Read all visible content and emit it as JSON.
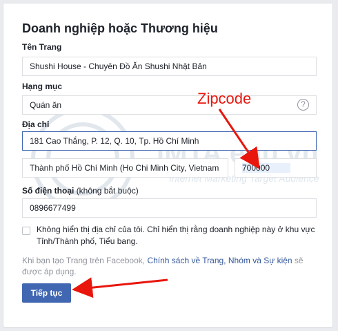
{
  "form": {
    "title": "Doanh nghiệp hoặc Thương hiệu",
    "page_name_label": "Tên Trang",
    "page_name_value": "Shushi House - Chuyên Đồ Ăn Shushi Nhật Bản",
    "category_label": "Hạng mục",
    "category_value": "Quán ăn",
    "help_glyph": "?",
    "address_label": "Địa chỉ",
    "address_value": "181 Cao Thắng, P. 12, Q. 10, Tp. Hồ Chí Minh",
    "city_value": "Thành phố Hồ Chí Minh (Ho Chi Minh City, Vietnam",
    "zip_value": "700000",
    "phone_label": "Số điện thoại",
    "phone_optional": "(không bắt buộc)",
    "phone_value": "0896677499",
    "hide_address_text": "Không hiển thị địa chỉ của tôi. Chỉ hiển thị rằng doanh nghiệp này ở khu vực Tỉnh/Thành phố, Tiểu bang.",
    "policy_prefix": "Khi bạn tạo Trang trên Facebook, ",
    "policy_link": "Chính sách về Trang, Nhóm và Sự kiện",
    "policy_suffix": " sẽ được áp dụng.",
    "continue_label": "Tiếp tục"
  },
  "annotation": {
    "zipcode_label": "Zipcode",
    "arrow_color": "#e8160c"
  },
  "watermark": {
    "brand": "IMTA.edu.vn",
    "tagline": "Internet Marketing Target Audience"
  },
  "colors": {
    "primary": "#4267b2",
    "link": "#365899",
    "annotation_red": "#e8160c"
  }
}
